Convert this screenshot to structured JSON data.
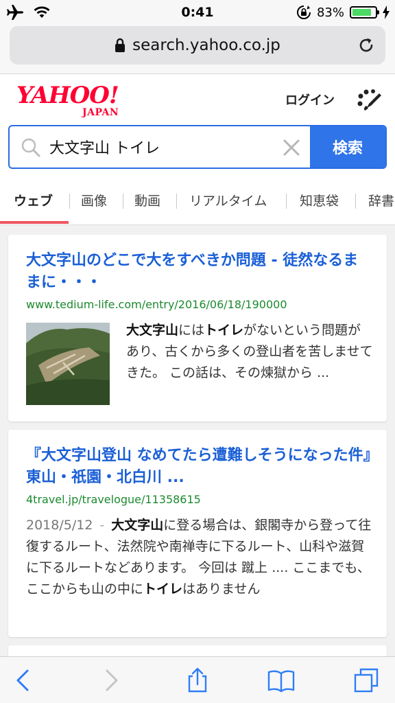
{
  "status_bar": {
    "time": "0:41",
    "battery_percent": "83%",
    "battery_level": 0.83,
    "icons": [
      "airplane-icon",
      "wifi-icon",
      "rotation-lock-icon",
      "battery-icon",
      "charging-icon"
    ]
  },
  "browser": {
    "url": "search.yahoo.co.jp",
    "icons": [
      "lock-icon",
      "reload-icon"
    ]
  },
  "header": {
    "logo_text": "YAHOO!",
    "logo_subtext": "JAPAN",
    "login_label": "ログイン",
    "menu_icon": "palette-brush-icon"
  },
  "search": {
    "query": "大文字山 トイレ",
    "button_label": "検索",
    "icons": [
      "search-icon",
      "clear-icon"
    ]
  },
  "tabs": [
    {
      "label": "ウェブ",
      "active": true
    },
    {
      "label": "画像",
      "active": false
    },
    {
      "label": "動画",
      "active": false
    },
    {
      "label": "リアルタイム",
      "active": false
    },
    {
      "label": "知恵袋",
      "active": false
    },
    {
      "label": "辞書",
      "active": false
    }
  ],
  "results": [
    {
      "title": "大文字山のどこで大をすべきか問題 - 徒然なるままに・・・",
      "url": "www.tedium-life.com/entry/2016/06/18/190000",
      "snippet": {
        "h1": "大文字山",
        "t1": "には",
        "h2": "トイレ",
        "t2": "がないという問題があり、古くから多くの登山者を苦しませてきた。 この話は、その煉獄から ..."
      }
    },
    {
      "title": "『大文字山登山 なめてたら遭難しそうになった件』東山・祇園・北白川 ...",
      "url": "4travel.jp/travelogue/11358615",
      "snippet": {
        "date": "2018/5/12",
        "dash": "-",
        "h1": "大文字山",
        "t1": "に登る場合は、銀閣寺から登って往復するルート、法然院や南禅寺に下るルート、山科や滋賀に下るルートなどあります。 今回は 蹴上 .... ここまでも、ここからも山の中に",
        "h2": "トイレ",
        "t2": "はありません"
      }
    }
  ],
  "toolbar": {
    "icons": [
      "back-icon",
      "forward-icon",
      "share-icon",
      "bookmarks-icon",
      "tabs-icon"
    ]
  },
  "colors": {
    "brand_red": "#ff0033",
    "link_blue": "#1a5fd6",
    "url_green": "#1b8a2e",
    "search_blue": "#2f74e8",
    "tab_active_underline": "#f0565f",
    "ios_blue": "#2f7df6"
  }
}
